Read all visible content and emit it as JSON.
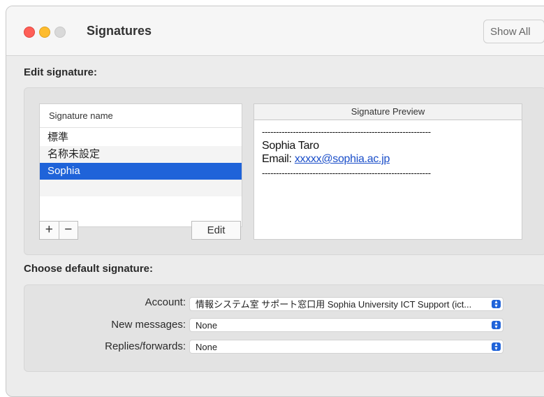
{
  "window": {
    "title": "Signatures",
    "show_all_label": "Show All"
  },
  "edit_section": {
    "label": "Edit signature:",
    "list_header": "Signature name",
    "items": [
      "標準",
      "名称未設定",
      "Sophia"
    ],
    "selected_index": 2,
    "add_label": "+",
    "remove_label": "−",
    "edit_label": "Edit"
  },
  "preview": {
    "header": "Signature Preview",
    "divider_top": "------------------------------------------------------------",
    "name": "Sophia Taro",
    "email_prefix": "Email: ",
    "email": "xxxxx@sophia.ac.jp",
    "divider_bottom": "------------------------------------------------------------"
  },
  "default_section": {
    "label": "Choose default signature:",
    "account_label": "Account:",
    "account_value": "情報システム室 サポート窓口用 Sophia University ICT Support (ict...",
    "new_messages_label": "New messages:",
    "new_messages_value": "None",
    "replies_label": "Replies/forwards:",
    "replies_value": "None"
  },
  "colors": {
    "selection": "#1f63d9",
    "link": "#1a4ec9"
  }
}
